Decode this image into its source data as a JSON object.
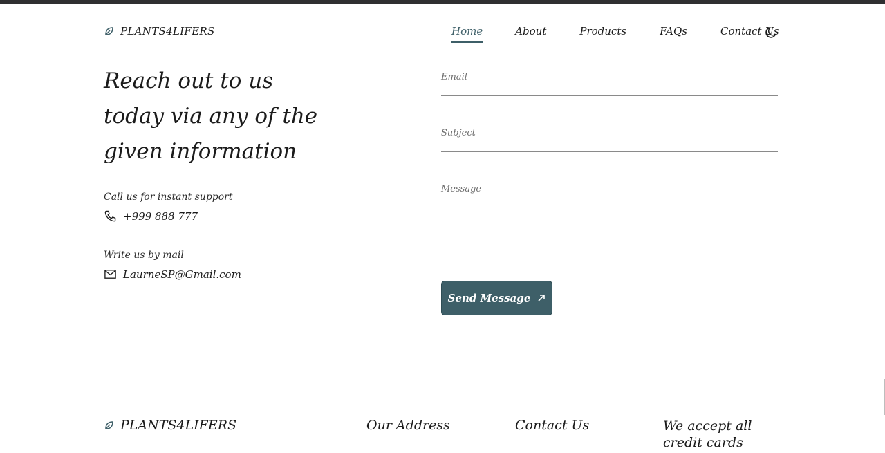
{
  "brand": {
    "name": "PLANTS4LIFERS"
  },
  "nav": {
    "items": [
      "Home",
      "About",
      "Products",
      "FAQs",
      "Contact Us"
    ],
    "active": "Home"
  },
  "hero": {
    "heading": "Reach out to us today via any of the given information"
  },
  "contact": {
    "phone_label": "Call us for instant support",
    "phone": "+999 888 777",
    "mail_label": "Write us by mail",
    "email": "LaurneSP@Gmail.com"
  },
  "form": {
    "email_placeholder": "Email",
    "subject_placeholder": "Subject",
    "message_placeholder": "Message",
    "send_label": "Send Message"
  },
  "footer": {
    "brand": "PLANTS4LIFERS",
    "address_title": "Our Address",
    "contact_title": "Contact Us",
    "cards_title": "We accept all credit cards"
  },
  "colors": {
    "accent": "#3e5f68",
    "topbar": "#2f2f31"
  },
  "icons": {
    "brand": "leaf-icon",
    "theme": "moon-icon",
    "phone": "phone-icon",
    "mail": "mail-icon",
    "send": "arrow-up-right-icon"
  }
}
